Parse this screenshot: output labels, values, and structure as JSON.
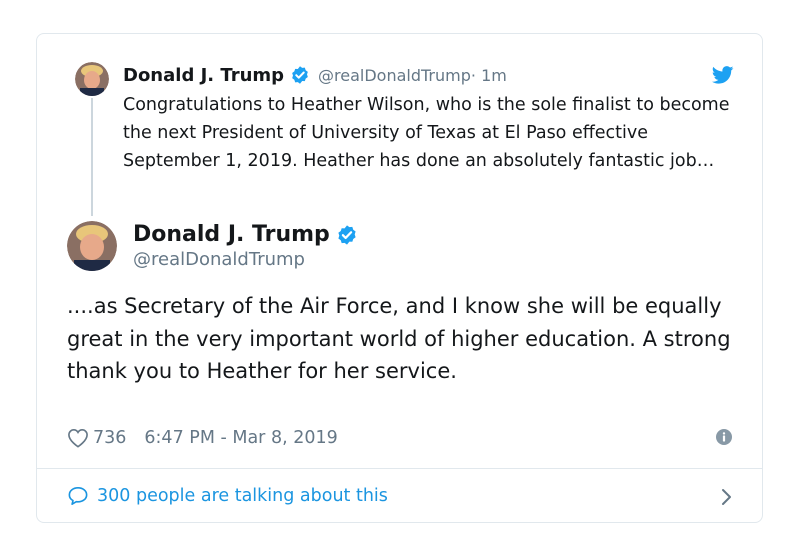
{
  "parent_tweet": {
    "name": "Donald J. Trump",
    "handle": "@realDonaldTrump",
    "time": " · 1m",
    "text": "Congratulations to Heather Wilson, who is the sole finalist to become the next President of University of Texas at El Paso effective September 1, 2019. Heather has done an absolutely fantastic job…"
  },
  "main_tweet": {
    "name": "Donald J. Trump",
    "handle": "@realDonaldTrump",
    "text": "....as Secretary of the Air Force, and I know she will be equally great in the very important world of higher education. A strong thank you to Heather for her service.",
    "likes": "736",
    "timestamp": "6:47 PM - Mar 8, 2019"
  },
  "footer": {
    "conversation_label": "300 people are talking about this"
  },
  "icons": {
    "verified": "verified-badge-icon",
    "bird": "twitter-bird-icon",
    "heart": "heart-icon",
    "info": "info-icon",
    "bubble": "speech-bubble-icon",
    "chevron": "chevron-right-icon"
  },
  "colors": {
    "twitter_blue": "#1da1f2",
    "link_blue": "#1b95e0",
    "secondary_text": "#657786",
    "border": "#e1e8ed"
  }
}
